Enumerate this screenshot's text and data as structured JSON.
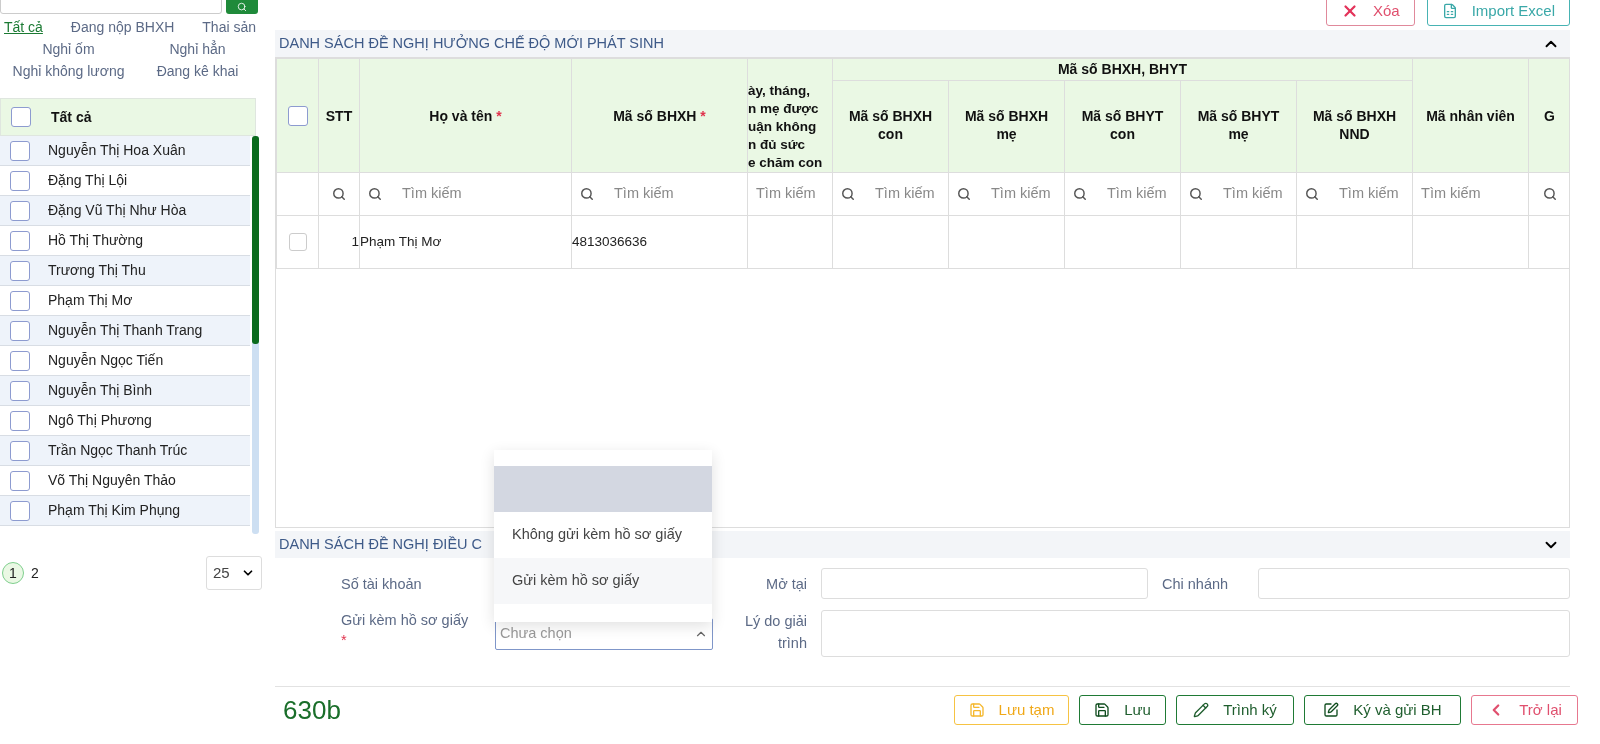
{
  "sidebar": {
    "filters": [
      {
        "label": "Tất cả",
        "selected": true
      },
      {
        "label": "Đang nộp BHXH",
        "selected": false
      },
      {
        "label": "Thai sản",
        "selected": false
      },
      {
        "label": "Nghỉ ốm",
        "selected": false
      },
      {
        "label": "Nghỉ hẳn",
        "selected": false
      },
      {
        "label": "Nghỉ không lương",
        "selected": false
      },
      {
        "label": "Đang kê khai",
        "selected": false
      }
    ],
    "list_header": {
      "label": "Tất cả",
      "checked": false
    },
    "employees": [
      {
        "name": "Nguyễn Thị Hoa Xuân",
        "checked": false
      },
      {
        "name": "Đặng Thị Lội",
        "checked": false
      },
      {
        "name": "Đặng Vũ Thị Như Hòa",
        "checked": false
      },
      {
        "name": "Hồ Thị Thường",
        "checked": false
      },
      {
        "name": "Trương Thị Thu",
        "checked": false
      },
      {
        "name": "Phạm Thị Mơ",
        "checked": false
      },
      {
        "name": "Nguyễn Thị Thanh Trang",
        "checked": false
      },
      {
        "name": "Nguyễn Ngọc Tiến",
        "checked": false
      },
      {
        "name": "Nguyễn Thị Bình",
        "checked": false
      },
      {
        "name": "Ngô Thị Phương",
        "checked": false
      },
      {
        "name": "Trần Ngọc Thanh Trúc",
        "checked": false
      },
      {
        "name": "Võ Thị Nguyên Thảo",
        "checked": false
      },
      {
        "name": "Phạm Thị Kim Phụng",
        "checked": false
      }
    ],
    "pagination": {
      "pages": [
        {
          "label": "1",
          "selected": true
        },
        {
          "label": "2",
          "selected": false
        }
      ],
      "page_size": "25"
    }
  },
  "toolbar": [
    {
      "label": "Xóa",
      "kind": "delete"
    },
    {
      "label": "Import Excel",
      "kind": "import"
    }
  ],
  "section_1": {
    "title": "DANH SÁCH ĐỀ NGHỊ HƯỞNG CHẾ ĐỘ MỚI PHÁT SINH",
    "expanded": true
  },
  "table": {
    "group_header": "Mã số BHXH, BHYT",
    "columns": [
      {
        "kind": "check",
        "checked": false
      },
      {
        "kind": "text",
        "lines": [
          "STT"
        ],
        "search_icon": true
      },
      {
        "kind": "text",
        "lines": [
          "Họ và tên"
        ],
        "required_mark": "*",
        "search_icon": true,
        "placeholder": "Tìm kiếm"
      },
      {
        "kind": "text",
        "lines": [
          "Mã số BHXH"
        ],
        "required_mark": "*",
        "search_icon": true,
        "placeholder": "Tìm kiếm"
      },
      {
        "kind": "text",
        "lines": [
          "ày, tháng,",
          "n mẹ được",
          "uận không",
          "n đủ sức",
          "e chăm con"
        ],
        "search_icon": false,
        "placeholder": "Tìm kiếm"
      },
      {
        "kind": "group",
        "lines": [
          "Mã số BHXH",
          "con"
        ],
        "search_icon": true,
        "placeholder": "Tìm kiếm"
      },
      {
        "kind": "group",
        "lines": [
          "Mã số BHXH",
          "mẹ"
        ],
        "search_icon": true,
        "placeholder": "Tìm kiếm"
      },
      {
        "kind": "group",
        "lines": [
          "Mã số BHYT",
          "con"
        ],
        "search_icon": true,
        "placeholder": "Tìm kiếm"
      },
      {
        "kind": "group",
        "lines": [
          "Mã số BHYT",
          "mẹ"
        ],
        "search_icon": true,
        "placeholder": "Tìm kiếm"
      },
      {
        "kind": "group",
        "lines": [
          "Mã số BHXH",
          "NND"
        ],
        "search_icon": true,
        "placeholder": "Tìm kiếm"
      },
      {
        "kind": "text",
        "lines": [
          "Mã nhân viên"
        ],
        "search_icon": false,
        "placeholder": "Tìm kiếm"
      },
      {
        "kind": "text",
        "lines": [
          "G"
        ],
        "search_icon": true
      }
    ],
    "rows": [
      {
        "checked": false,
        "cells": [
          "",
          "1",
          "Phạm Thị Mơ",
          "4813036636"
        ]
      }
    ]
  },
  "section_2": {
    "title": "DANH SÁCH ĐỀ NGHỊ ĐIỀU C",
    "expanded": false
  },
  "form": {
    "account_label": "Số tài khoản",
    "open_at_label": "Mở tại",
    "branch_label": "Chi nhánh",
    "paper_label": "Gửi kèm hồ sơ giấy",
    "paper_required_mark": "*",
    "paper_placeholder": "Chưa chọn",
    "paper_open": true,
    "reason_label": "Lý do giải trình"
  },
  "dropdown": {
    "blank_option": {
      "selected": true
    },
    "options": [
      {
        "label": "Không gửi kèm hồ sơ giấy",
        "selected": false
      },
      {
        "label": "Gửi kèm hồ sơ giấy",
        "selected": false
      }
    ]
  },
  "footer": {
    "code": "630b",
    "buttons": [
      {
        "label": "Lưu tạm",
        "kind": "draft"
      },
      {
        "label": "Lưu",
        "kind": "save"
      },
      {
        "label": "Trình ký",
        "kind": "submit"
      },
      {
        "label": "Ký và gửi BH",
        "kind": "sign"
      },
      {
        "label": "Trở lại",
        "kind": "back"
      }
    ]
  }
}
